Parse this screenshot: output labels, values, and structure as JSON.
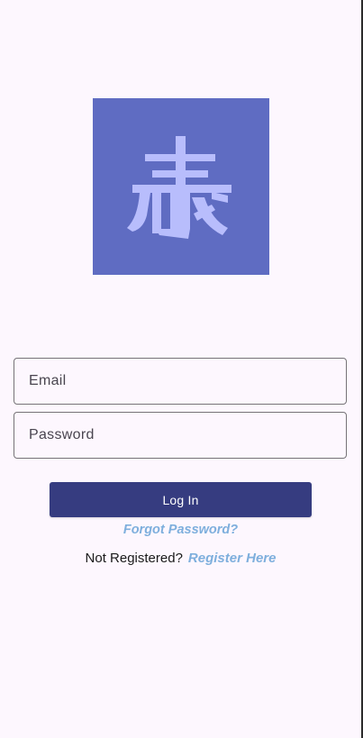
{
  "logo": {
    "icon": "kanji-logo-icon",
    "background_color": "#5f6cc2",
    "glyph_color": "#b8bdfc"
  },
  "form": {
    "email_placeholder": "Email",
    "password_placeholder": "Password"
  },
  "actions": {
    "login_label": "Log In",
    "forgot_label": "Forgot Password?",
    "register_prompt": "Not Registered?",
    "register_link": "Register Here"
  },
  "colors": {
    "primary_button": "#363c80",
    "link": "#7eafdd",
    "background": "#fdf7fe"
  }
}
